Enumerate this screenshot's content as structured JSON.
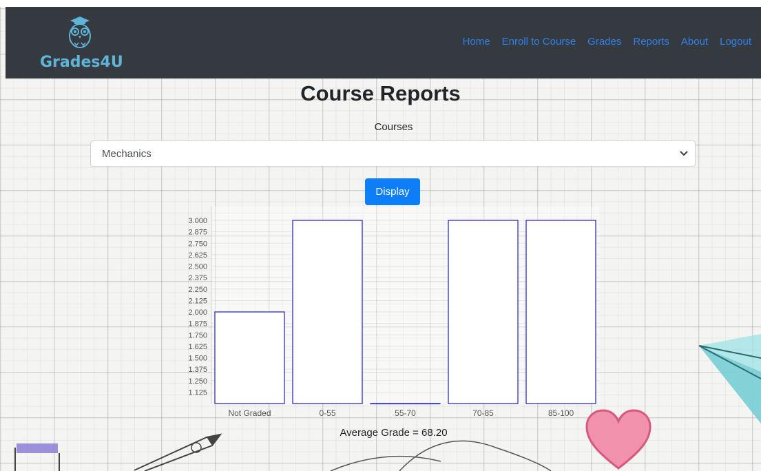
{
  "nav": {
    "brand": "Grades4U",
    "links": [
      "Home",
      "Enroll to Course",
      "Grades",
      "Reports",
      "About",
      "Logout"
    ]
  },
  "page": {
    "title": "Course Reports",
    "courses_label": "Courses",
    "course_selected": "Mechanics",
    "display_button": "Display",
    "average_text": "Average Grade = 68.20"
  },
  "colors": {
    "navbar": "#343a40",
    "link": "#2f80ed",
    "button": "#0d7ef7",
    "bar_border": "#1f1fb8",
    "brand": "#5fb4d9"
  },
  "chart_data": {
    "type": "bar",
    "categories": [
      "Not Graded",
      "0-55",
      "55-70",
      "70-85",
      "85-100"
    ],
    "values": [
      2,
      3,
      0,
      3,
      3
    ],
    "ylim": [
      1,
      3
    ],
    "yticks": [
      "1.125",
      "1.250",
      "1.375",
      "1.500",
      "1.625",
      "1.750",
      "1.875",
      "2.000",
      "2.125",
      "2.250",
      "2.375",
      "2.500",
      "2.625",
      "2.750",
      "2.875",
      "3.000"
    ],
    "grid": true,
    "legend": "none"
  }
}
